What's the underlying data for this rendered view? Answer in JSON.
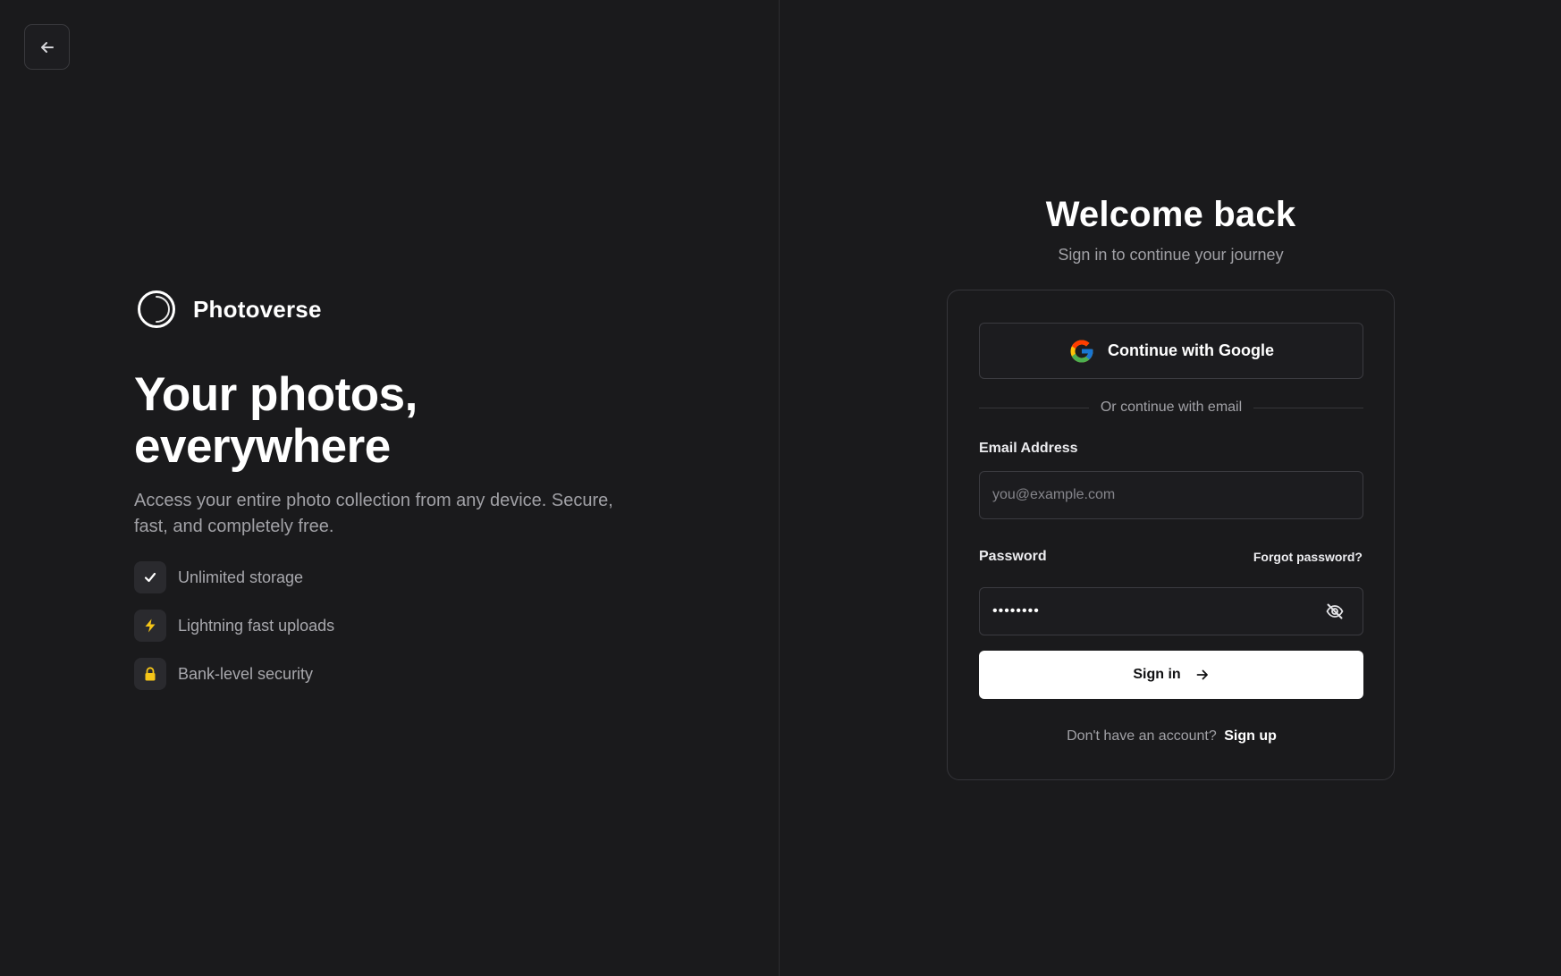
{
  "nav": {
    "back_icon": "arrow-left-icon"
  },
  "brand": {
    "name": "Photoverse",
    "logo_icon": "circle-logo-icon"
  },
  "hero": {
    "title_line1": "Your photos,",
    "title_line2": "everywhere",
    "subtitle": "Access your entire photo collection from any device. Secure, fast, and completely free."
  },
  "features": [
    {
      "label": "Unlimited storage",
      "icon": "check-icon"
    },
    {
      "label": "Lightning fast uploads",
      "icon": "lightning-icon"
    },
    {
      "label": "Bank-level security",
      "icon": "lock-icon"
    }
  ],
  "auth": {
    "title": "Welcome back",
    "subtitle": "Sign in to continue your journey",
    "google_label": "Continue with Google",
    "divider_text": "Or continue with email",
    "email_label": "Email Address",
    "email_placeholder": "you@example.com",
    "email_value": "",
    "password_label": "Password",
    "forgot_label": "Forgot password?",
    "password_value": "••••••••",
    "signin_label": "Sign in",
    "signup_prompt": "Don't have an account?",
    "signup_link": "Sign up"
  },
  "colors": {
    "background": "#1a1a1c",
    "accent_yellow": "#f5c518",
    "primary_button": "#ffffff",
    "muted_text": "#a1a1a6"
  }
}
